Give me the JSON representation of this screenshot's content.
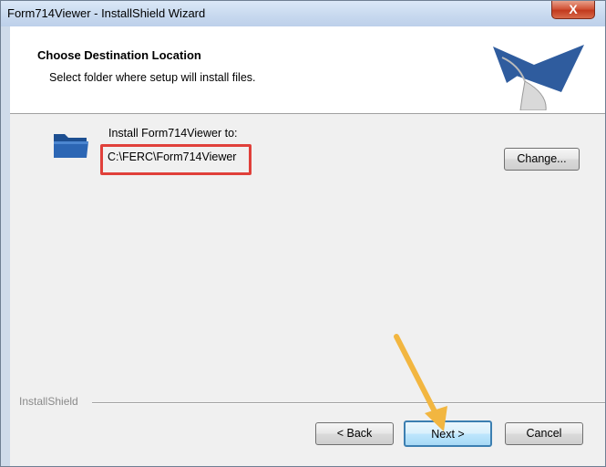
{
  "window": {
    "title": "Form714Viewer - InstallShield Wizard",
    "close_label": "X"
  },
  "header": {
    "title": "Choose Destination Location",
    "subtitle": "Select folder where setup will install files."
  },
  "main": {
    "install_label": "Install Form714Viewer to:",
    "install_path": "C:\\FERC\\Form714Viewer",
    "change_button": "Change..."
  },
  "footer": {
    "brand": "InstallShield",
    "back_button": "< Back",
    "next_button": "Next >",
    "cancel_button": "Cancel"
  },
  "colors": {
    "highlight_box": "#e0403a",
    "annotation_arrow": "#f2b640",
    "logo_blue": "#2f5c9e"
  },
  "icons": {
    "folder": "folder-icon",
    "logo": "installshield-logo",
    "arrow": "annotation-arrow"
  }
}
